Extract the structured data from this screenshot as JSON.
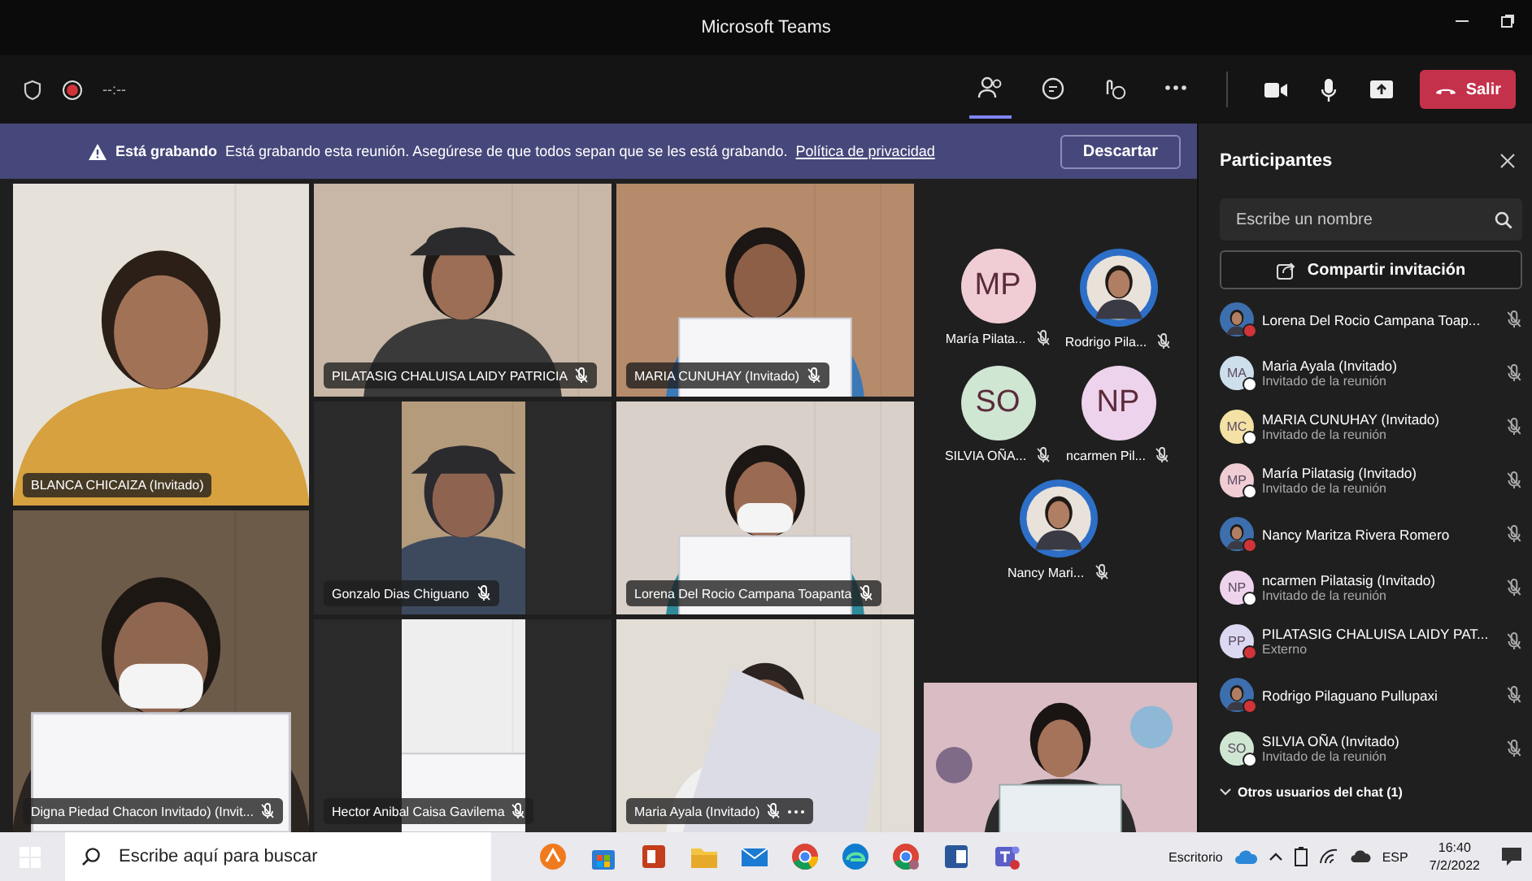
{
  "window": {
    "title": "Microsoft Teams"
  },
  "toolbar": {
    "recording": true,
    "timer": "--:--",
    "leave_button": "Salir",
    "tools": [
      {
        "kind": "people",
        "selected": true
      },
      {
        "kind": "chat",
        "selected": false
      },
      {
        "kind": "reactions",
        "selected": false
      },
      {
        "kind": "more",
        "selected": false
      }
    ]
  },
  "recording_banner": {
    "title": "Está grabando",
    "message": "Está grabando esta reunión. Asegúrese de que todos sepan que se les está grabando.",
    "link": "Política de privacidad",
    "dismiss": "Descartar"
  },
  "gallery": {
    "columns": [
      [
        {
          "name": "BLANCA CHICAIZA (Invitado)",
          "muted": false,
          "more": false
        },
        {
          "name": "Digna Piedad Chacon Invitado) (Invit...",
          "muted": true,
          "more": false
        }
      ],
      [
        {
          "name": "PILATASIG CHALUISA LAIDY PATRICIA",
          "muted": true,
          "more": false
        },
        {
          "name": "Gonzalo Dias Chiguano",
          "muted": true,
          "more": false
        },
        {
          "name": "Hector Anibal Caisa Gavilema",
          "muted": true,
          "more": false
        }
      ],
      [
        {
          "name": "MARIA CUNUHAY (Invitado)",
          "muted": true,
          "more": false
        },
        {
          "name": "Lorena Del Rocio Campana Toapanta",
          "muted": true,
          "more": false
        },
        {
          "name": "Maria Ayala (Invitado)",
          "muted": true,
          "more": true
        }
      ]
    ],
    "avatars": [
      {
        "kind": "initials",
        "initials": "MP",
        "name": "María Pilata...",
        "color": "#f0cdd5",
        "muted": true
      },
      {
        "name": "Rodrigo Pila...",
        "muted": true
      },
      {
        "kind": "initials",
        "initials": "SO",
        "name": "SILVIA OÑA...",
        "color": "#cfe6d3",
        "muted": true
      },
      {
        "kind": "initials",
        "initials": "NP",
        "name": "ncarmen Pil...",
        "color": "#eed3ec",
        "muted": true
      },
      {
        "name": "Nancy Mari...",
        "muted": true
      }
    ],
    "extra_tile": {
      "kind": "picture"
    }
  },
  "participants_panel": {
    "title": "Participantes",
    "search": {
      "placeholder": "Escribe un nombre"
    },
    "share_button": "Compartir invitación",
    "items": [
      {
        "name": "Lorena Del Rocio Campana Toap...",
        "status": {
          "color": "#d13438"
        }
      },
      {
        "kind": "initials",
        "avatar": {
          "initials": "MA",
          "color": "#cddfeb"
        },
        "name": "Maria Ayala (Invitado)",
        "subtitle": "Invitado de la reunión",
        "status": {
          "color": "#ffffff"
        }
      },
      {
        "kind": "initials",
        "avatar": {
          "initials": "MC",
          "color": "#f3e2a4"
        },
        "name": "MARIA CUNUHAY (Invitado)",
        "subtitle": "Invitado de la reunión",
        "status": {
          "color": "#ffffff"
        }
      },
      {
        "kind": "initials",
        "avatar": {
          "initials": "MP",
          "color": "#f0cdd5"
        },
        "name": "María Pilatasig (Invitado)",
        "subtitle": "Invitado de la reunión",
        "status": {
          "color": "#ffffff"
        }
      },
      {
        "name": "Nancy Maritza Rivera Romero",
        "status": {
          "color": "#d13438"
        }
      },
      {
        "kind": "initials",
        "avatar": {
          "initials": "NP",
          "color": "#eed3ec"
        },
        "name": "ncarmen Pilatasig (Invitado)",
        "subtitle": "Invitado de la reunión",
        "status": {
          "color": "#ffffff"
        }
      },
      {
        "kind": "initials",
        "avatar": {
          "initials": "PP",
          "color": "#dcd8f2"
        },
        "name": "PILATASIG CHALUISA LAIDY PAT...",
        "subtitle": "Externo",
        "status": {
          "color": "#d13438"
        }
      },
      {
        "name": "Rodrigo Pilaguano Pullupaxi",
        "status": {
          "color": "#d13438"
        }
      },
      {
        "kind": "initials",
        "avatar": {
          "initials": "SO",
          "color": "#cfe6d3"
        },
        "name": "SILVIA OÑA (Invitado)",
        "subtitle": "Invitado de la reunión",
        "status": {
          "color": "#ffffff"
        }
      }
    ],
    "section": "Otros usuarios del chat (1)"
  },
  "taskbar": {
    "search": {
      "placeholder": "Escribe aquí para buscar"
    },
    "desktop_label": "Escritorio",
    "language": "ESP",
    "time": "16:40",
    "date": "7/2/2022"
  }
}
